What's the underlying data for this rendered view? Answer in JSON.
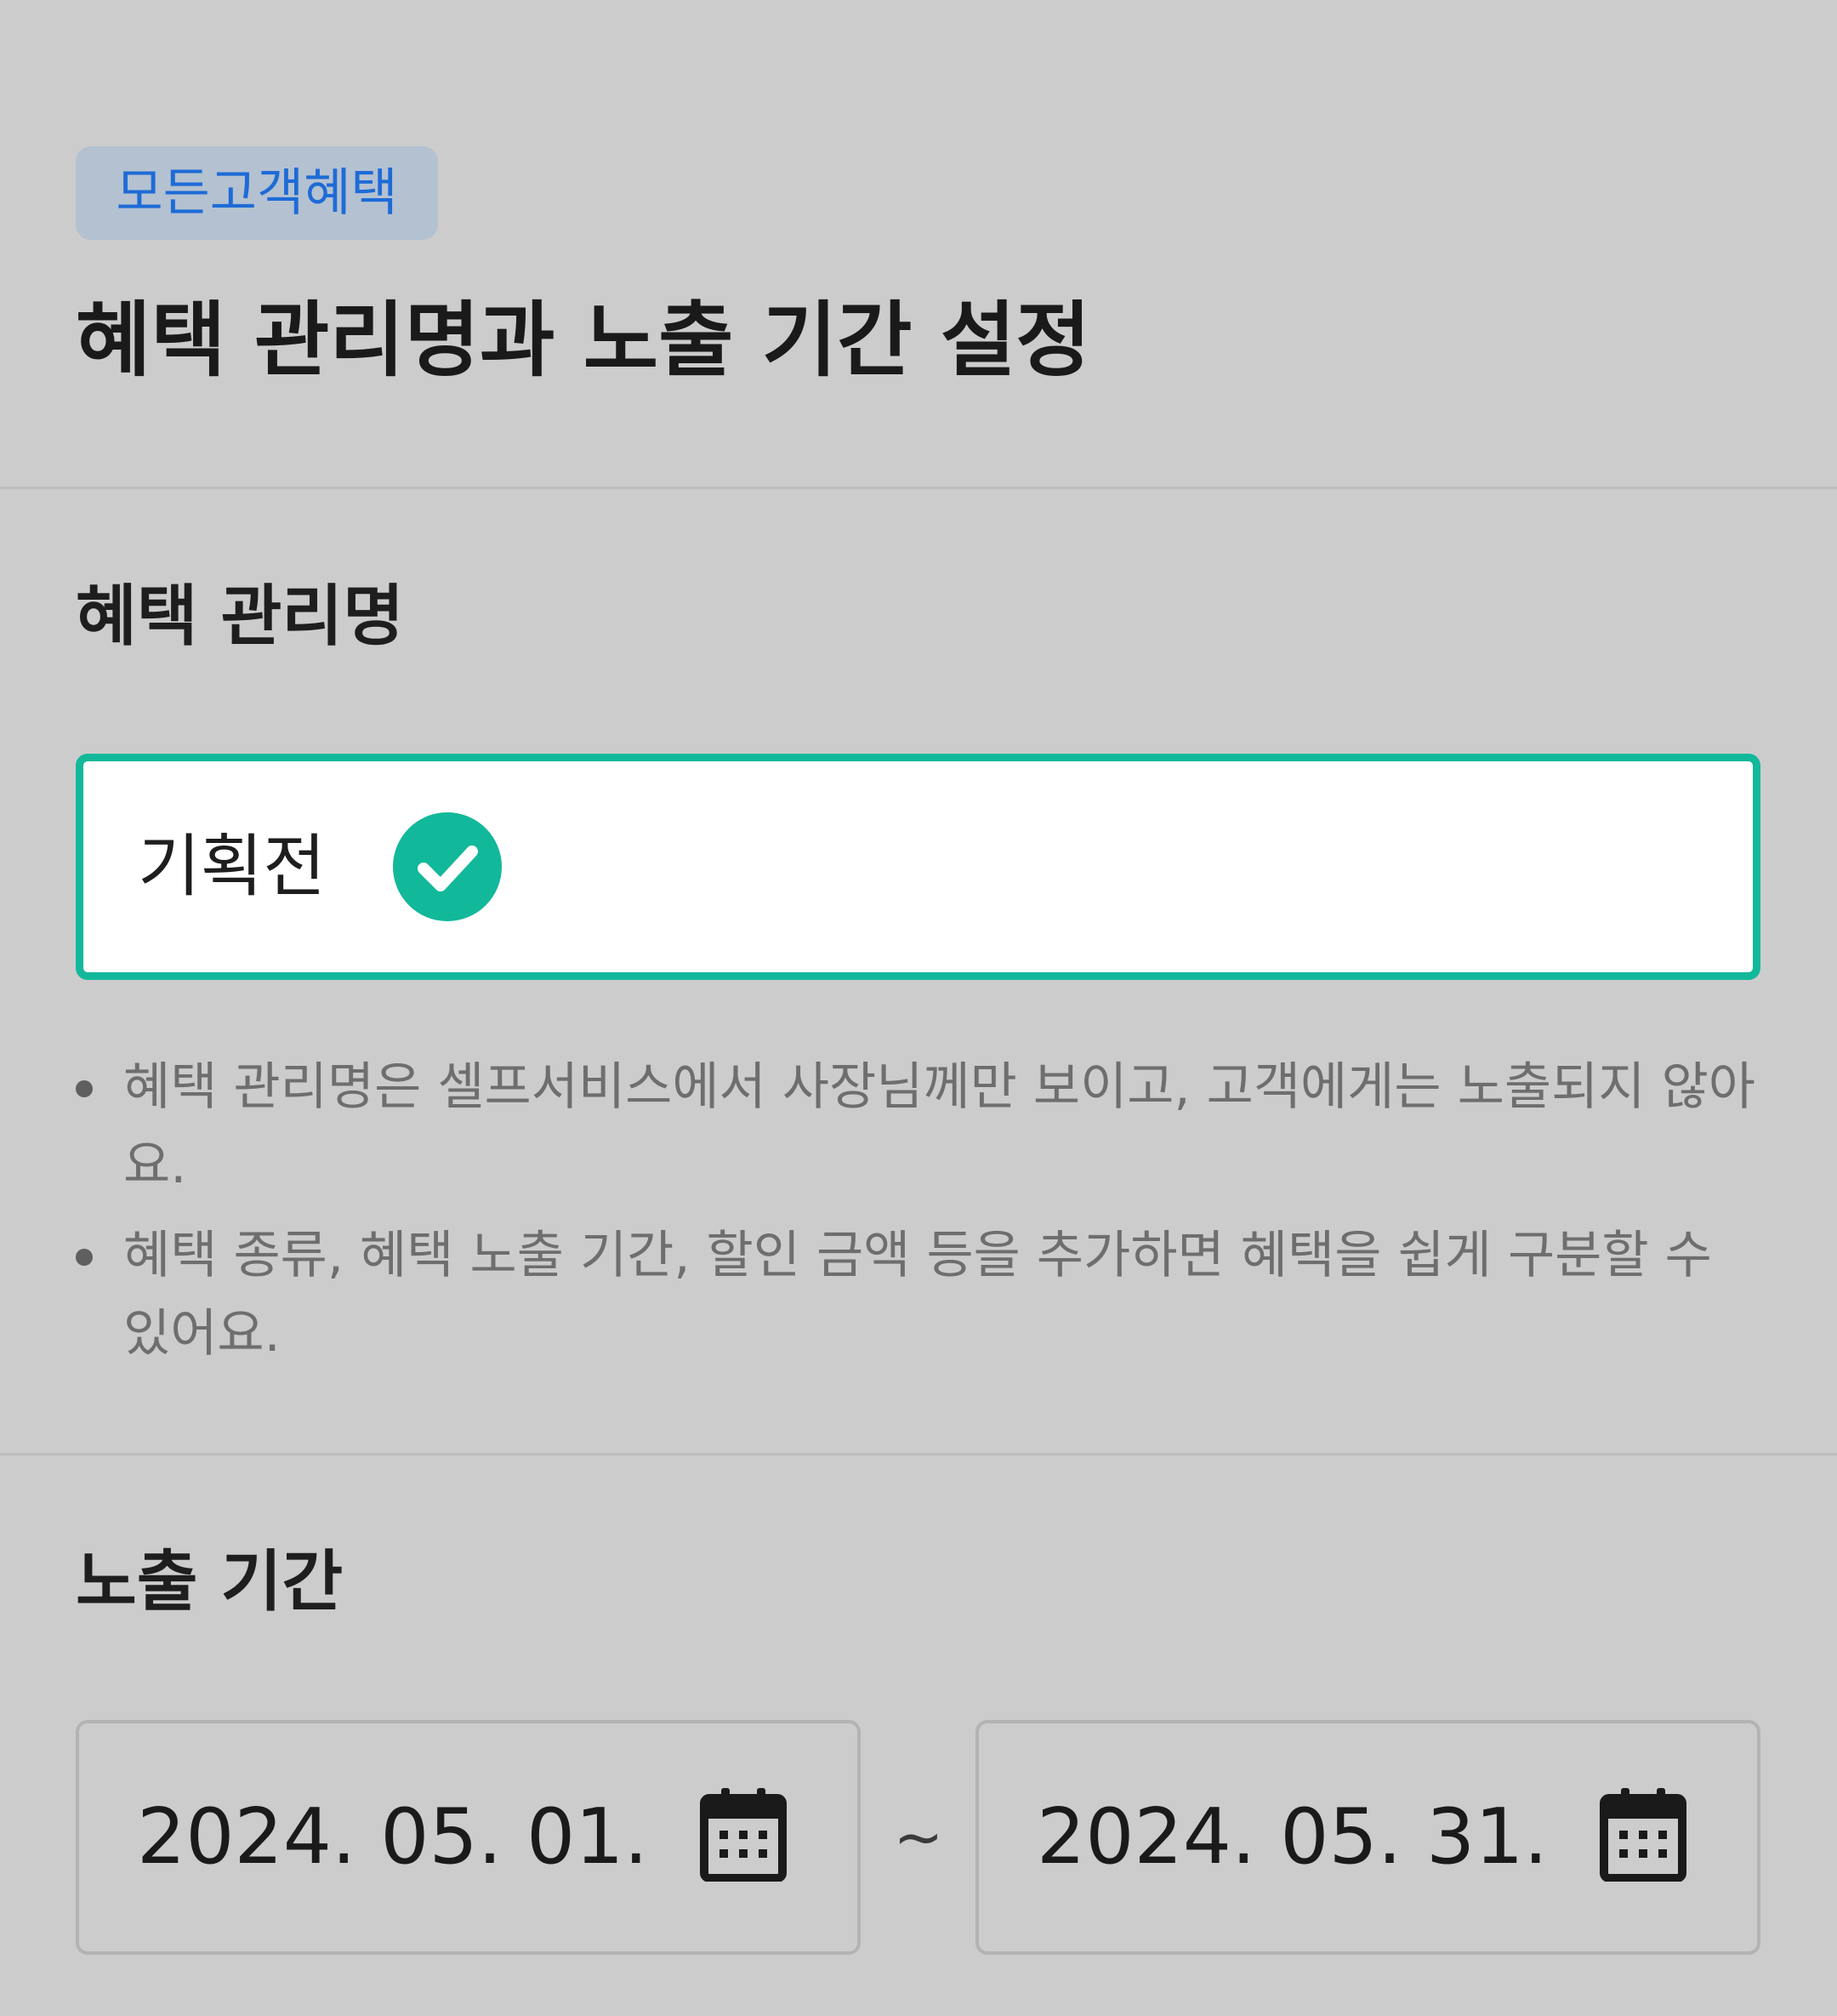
{
  "header": {
    "badge": "모든고객혜택",
    "title": "혜택 관리명과 노출 기간 설정"
  },
  "benefit_name": {
    "label": "혜택 관리명",
    "value": "기획전",
    "status_icon": "check-circle-icon",
    "hints": [
      "혜택 관리명은 셀프서비스에서 사장님께만 보이고, 고객에게는 노출되지 않아요.",
      "혜택 종류, 혜택 노출 기간, 할인 금액 등을 추가하면 혜택을 쉽게 구분할 수 있어요."
    ]
  },
  "exposure_period": {
    "label": "노출 기간",
    "start_date": "2024. 05. 01.",
    "end_date": "2024. 05. 31.",
    "separator": "~",
    "icon": "calendar-icon"
  },
  "colors": {
    "background": "#cccccc",
    "accent_green": "#12b89a",
    "badge_background": "#b3c1d1",
    "badge_text": "#1e6bd6",
    "hint_text": "#6e6e6e"
  }
}
